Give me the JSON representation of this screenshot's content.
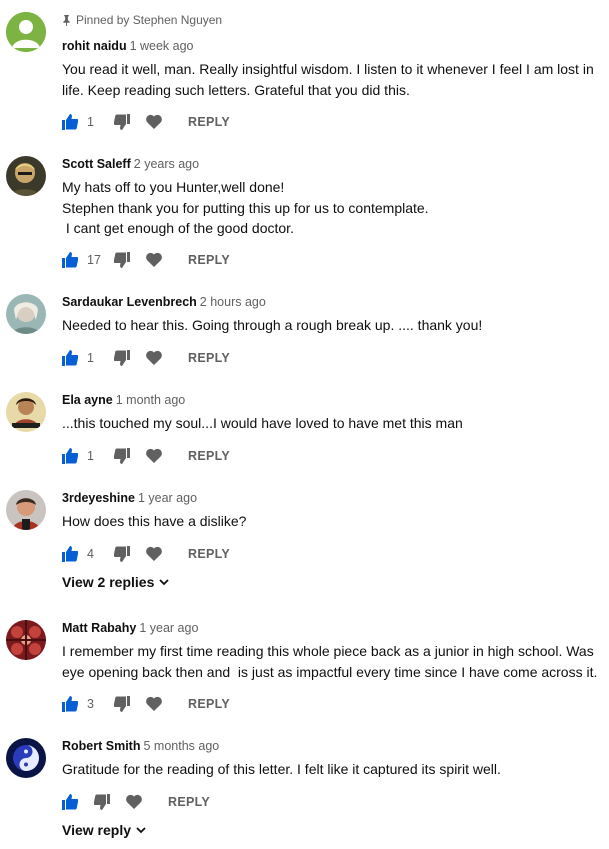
{
  "pinned_label": "Pinned by Stephen Nguyen",
  "reply_label": "REPLY",
  "colors": {
    "like_blue": "#065fd4",
    "icon_gray": "#606060",
    "text": "#0f0f0f"
  },
  "comments": [
    {
      "author": "rohit naidu",
      "time": "1 week ago",
      "text": "You read it well, man. Really insightful wisdom. I listen to it whenever I feel I am lost in\nlife. Keep reading such letters. Grateful that you did this.",
      "likes": "1",
      "avatar": "default-avatar"
    },
    {
      "author": "Scott Saleff",
      "time": "2 years ago",
      "text": "My hats off to you Hunter,well done!\nStephen thank you for putting this up for us to contemplate.\n I cant get enough of the good doctor.",
      "likes": "17",
      "avatar": "portrait-avatar"
    },
    {
      "author": "Sardaukar Levenbrech",
      "time": "2 hours ago",
      "text": "Needed to hear this. Going through a rough break up. .... thank you!",
      "likes": "1",
      "avatar": "portrait-avatar"
    },
    {
      "author": "Ela ayne",
      "time": "1 month ago",
      "text": "...this touched my soul...I would have loved to have met this man",
      "likes": "1",
      "avatar": "portrait-avatar"
    },
    {
      "author": "3rdeyeshine",
      "time": "1 year ago",
      "text": "How does this have a dislike?",
      "likes": "4",
      "avatar": "portrait-avatar",
      "view_replies": "View 2 replies"
    },
    {
      "author": "Matt Rabahy",
      "time": "1 year ago",
      "text": "I remember my first time reading this whole piece back as a junior in high school. Was\neye opening back then and  is just as impactful every time since I have come across it.",
      "likes": "3",
      "avatar": "pattern-avatar"
    },
    {
      "author": "Robert Smith",
      "time": "5 months ago",
      "text": "Gratitude for the reading of this letter. I felt like it captured its spirit well.",
      "likes": "",
      "avatar": "yin-yang-avatar",
      "view_replies": "View reply"
    }
  ]
}
